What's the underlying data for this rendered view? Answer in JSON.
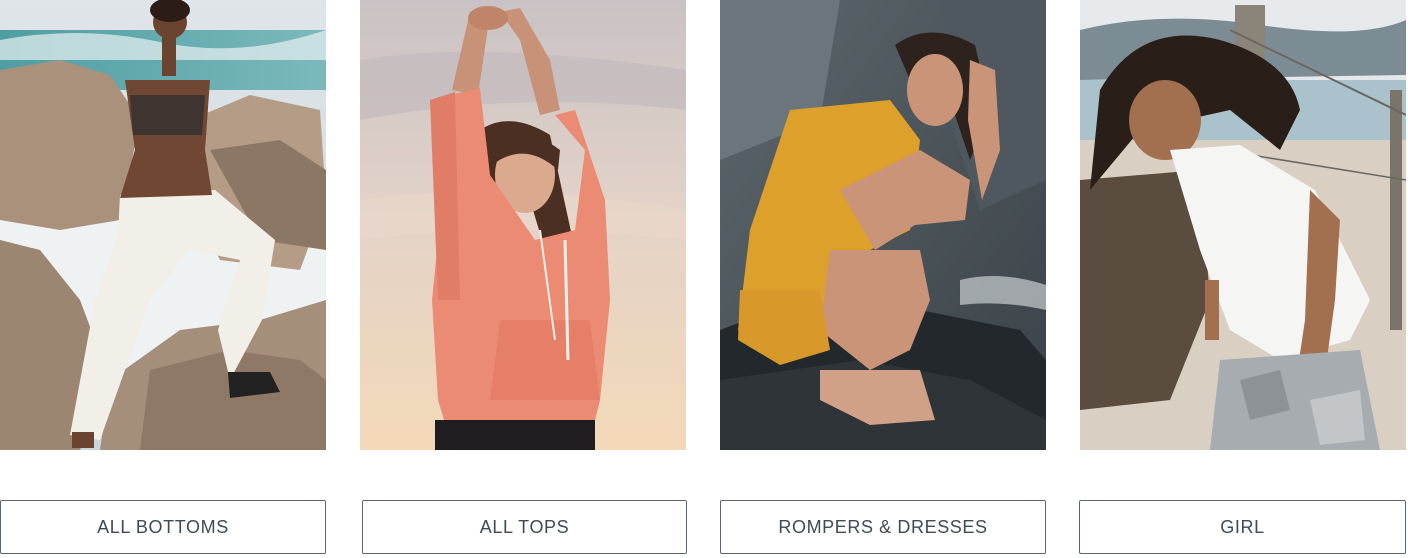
{
  "tiles": [
    {
      "label": "ALL BOTTOMS",
      "image": "woman-on-beach-rocks-white-joggers"
    },
    {
      "label": "ALL TOPS",
      "image": "woman-stretching-coral-hoodie"
    },
    {
      "label": "ROMPERS & DRESSES",
      "image": "woman-crouching-mustard-romper"
    },
    {
      "label": "GIRL",
      "image": "girl-white-tank-camo-leggings"
    }
  ],
  "colors": {
    "button_border": "#5a6570",
    "button_text": "#414a53",
    "background": "#ffffff"
  }
}
